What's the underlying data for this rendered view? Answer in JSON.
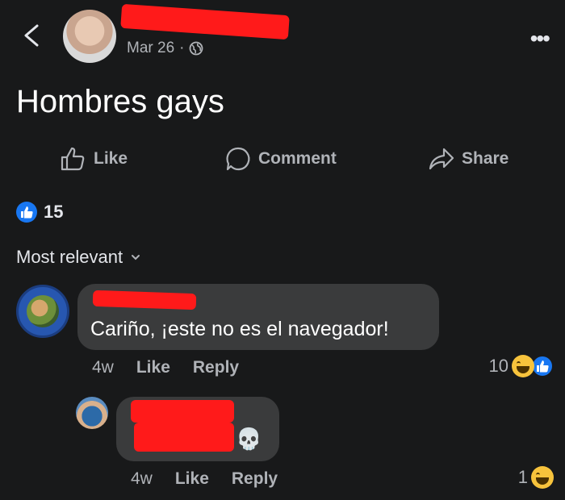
{
  "post": {
    "date": "Mar 26",
    "date_separator": "·",
    "text": "Hombres gays",
    "more_label": "•••"
  },
  "actions": {
    "like_label": "Like",
    "comment_label": "Comment",
    "share_label": "Share"
  },
  "reactions": {
    "count": "15"
  },
  "sort": {
    "label": "Most relevant"
  },
  "comments": [
    {
      "text": "Cariño, ¡este no es el navegador!",
      "time": "4w",
      "like_label": "Like",
      "reply_label": "Reply",
      "reaction_count": "10"
    },
    {
      "text": "",
      "emoji": "💀",
      "time": "4w",
      "like_label": "Like",
      "reply_label": "Reply",
      "reaction_count": "1"
    }
  ],
  "colors": {
    "background": "#18191a",
    "bubble": "#3a3b3c",
    "accent": "#1877f2",
    "redaction": "#ff1a1a"
  }
}
